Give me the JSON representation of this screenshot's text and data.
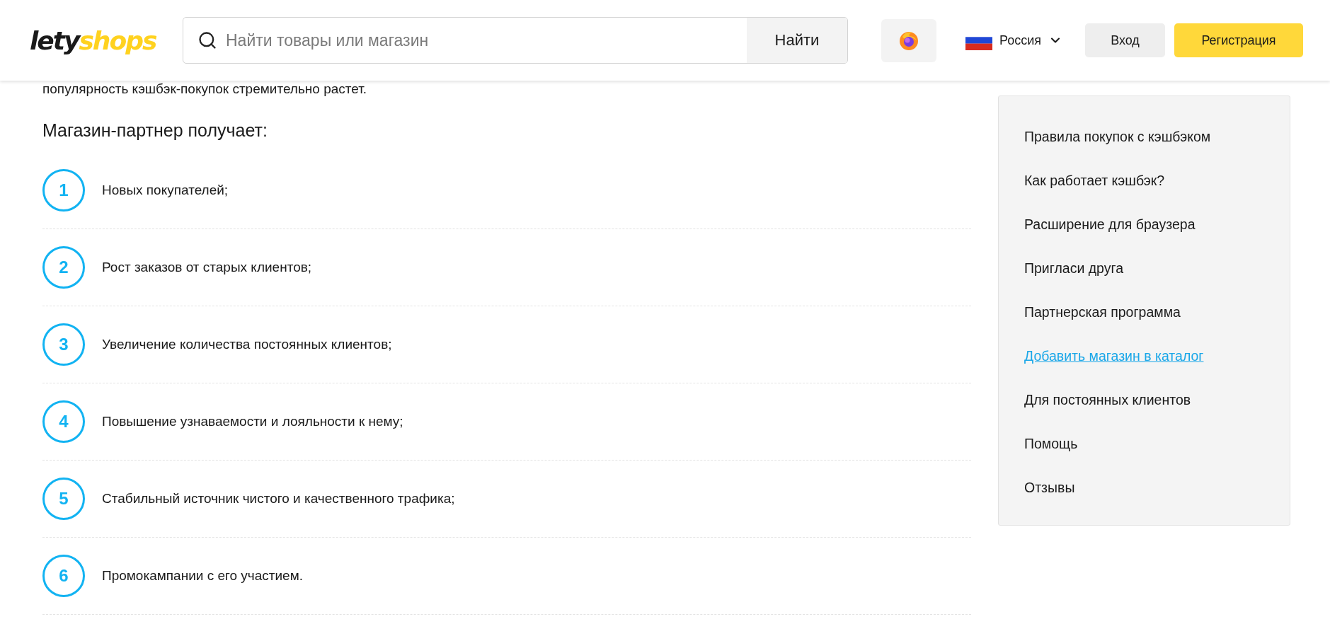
{
  "header": {
    "logo": [
      "lety",
      "shops"
    ],
    "search": {
      "placeholder": "Найти товары или магазин",
      "button": "Найти"
    },
    "region": "Россия",
    "login": "Вход",
    "register": "Регистрация"
  },
  "intro_line": "популярность кэшбэк-покупок стремительно растет.",
  "section": {
    "heading": "Магазин-партнер получает:",
    "items": [
      {
        "number": "1",
        "text": "Новых покупателей;"
      },
      {
        "number": "2",
        "text": "Рост заказов от старых клиентов;"
      },
      {
        "number": "3",
        "text": "Увеличение количества постоянных клиентов;"
      },
      {
        "number": "4",
        "text": "Повышение узнаваемости и лояльности к нему;"
      },
      {
        "number": "5",
        "text": "Стабильный источник чистого и качественного трафика;"
      },
      {
        "number": "6",
        "text": "Промокампании с его участием."
      }
    ]
  },
  "sidebar": {
    "items": [
      {
        "label": "Правила покупок с кэшбэком",
        "selected": false
      },
      {
        "label": "Как работает кэшбэк?",
        "selected": false
      },
      {
        "label": "Расширение для браузера",
        "selected": false
      },
      {
        "label": "Пригласи друга",
        "selected": false
      },
      {
        "label": "Партнерская программа",
        "selected": false
      },
      {
        "label": "Добавить магазин в каталог",
        "selected": true
      },
      {
        "label": "Для постоянных клиентов",
        "selected": false
      },
      {
        "label": "Помощь",
        "selected": false
      },
      {
        "label": "Отзывы",
        "selected": false
      }
    ]
  }
}
